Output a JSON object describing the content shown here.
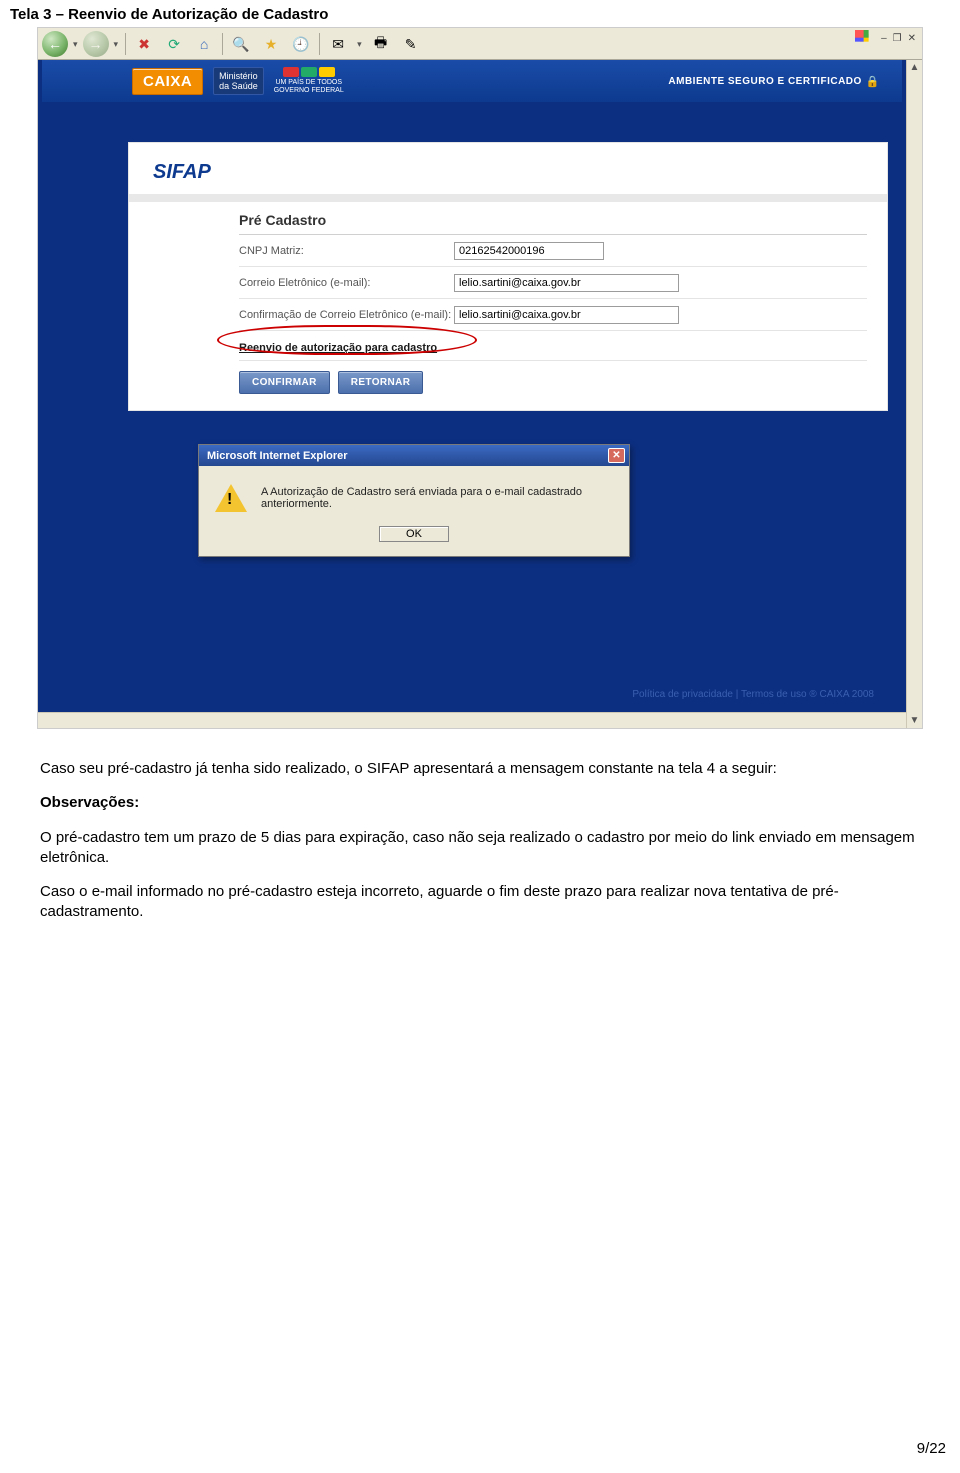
{
  "doc": {
    "title": "Tela 3 – Reenvio de Autorização de Cadastro",
    "para1": "Caso seu pré-cadastro já tenha sido realizado, o SIFAP apresentará a mensagem constante na tela 4 a seguir:",
    "obs_label": "Observações:",
    "para2": "O pré-cadastro tem um prazo de 5 dias para expiração, caso não seja realizado o cadastro por meio do link enviado em mensagem eletrônica.",
    "para3": "Caso o e-mail informado no pré-cadastro esteja incorreto, aguarde o fim deste prazo para realizar nova tentativa de pré-cadastramento.",
    "page_num": "9/22"
  },
  "brand": {
    "caixa": "CAIXA",
    "ministerio_l1": "Ministério",
    "ministerio_l2": "da Saúde",
    "pais_l1": "UM PAÍS DE TODOS",
    "pais_l2": "GOVERNO FEDERAL",
    "secure": "AMBIENTE SEGURO E CERTIFICADO"
  },
  "form": {
    "app_title": "SIFAP",
    "section_title": "Pré Cadastro",
    "fields": {
      "cnpj_label": "CNPJ Matriz:",
      "cnpj_value": "02162542000196",
      "email_label": "Correio Eletrônico (e-mail):",
      "email_value": "lelio.sartini@caixa.gov.br",
      "email2_label": "Confirmação de Correio Eletrônico (e-mail):",
      "email2_value": "lelio.sartini@caixa.gov.br"
    },
    "resend_link": "Reenvio de autorização para cadastro",
    "btn_confirm": "CONFIRMAR",
    "btn_return": "RETORNAR"
  },
  "dialog": {
    "title": "Microsoft Internet Explorer",
    "message": "A Autorização de Cadastro será enviada para o e-mail cadastrado anteriormente.",
    "ok": "OK"
  },
  "footer": {
    "privacy": "Política de privacidade",
    "terms": "Termos de uso",
    "copyright": "CAIXA 2008"
  },
  "icons": {
    "back": "←",
    "forward": "→",
    "stop": "✖",
    "refresh": "⟳",
    "home": "⌂",
    "search": "🔍",
    "favorites": "★",
    "history": "🕘",
    "mail": "✉",
    "print": "🖶",
    "edit": "✎",
    "chevron_down": "▾",
    "minimize": "–",
    "restore": "❐",
    "close": "✕",
    "scroll_up": "▲",
    "scroll_down": "▼",
    "scroll_left": "◀",
    "scroll_right": "▶",
    "lock": "🔒"
  }
}
